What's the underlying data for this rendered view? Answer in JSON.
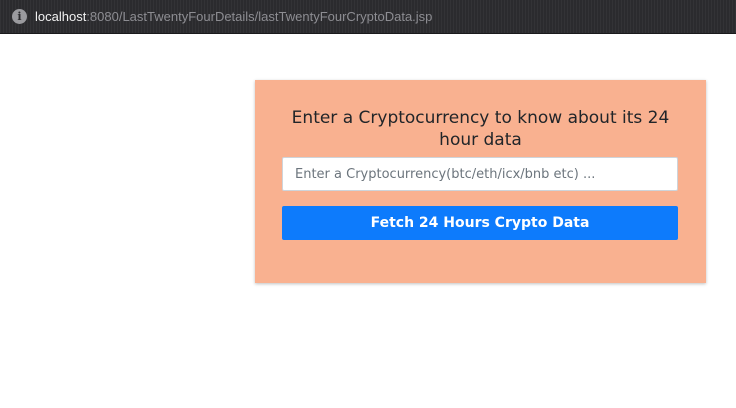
{
  "browser": {
    "url_host": "localhost",
    "url_path": ":8080/LastTwentyFourDetails/lastTwentyFourCryptoData.jsp",
    "info_icon": "info-icon"
  },
  "form": {
    "title": "Enter a Cryptocurrency to know about its 24 hour data",
    "input_value": "",
    "input_placeholder": "Enter a Cryptocurrency(btc/eth/icx/bnb etc) ...",
    "submit_label": "Fetch 24 Hours Crypto Data"
  },
  "colors": {
    "card_background": "#f9b190",
    "button_background": "#0d7bfc"
  }
}
